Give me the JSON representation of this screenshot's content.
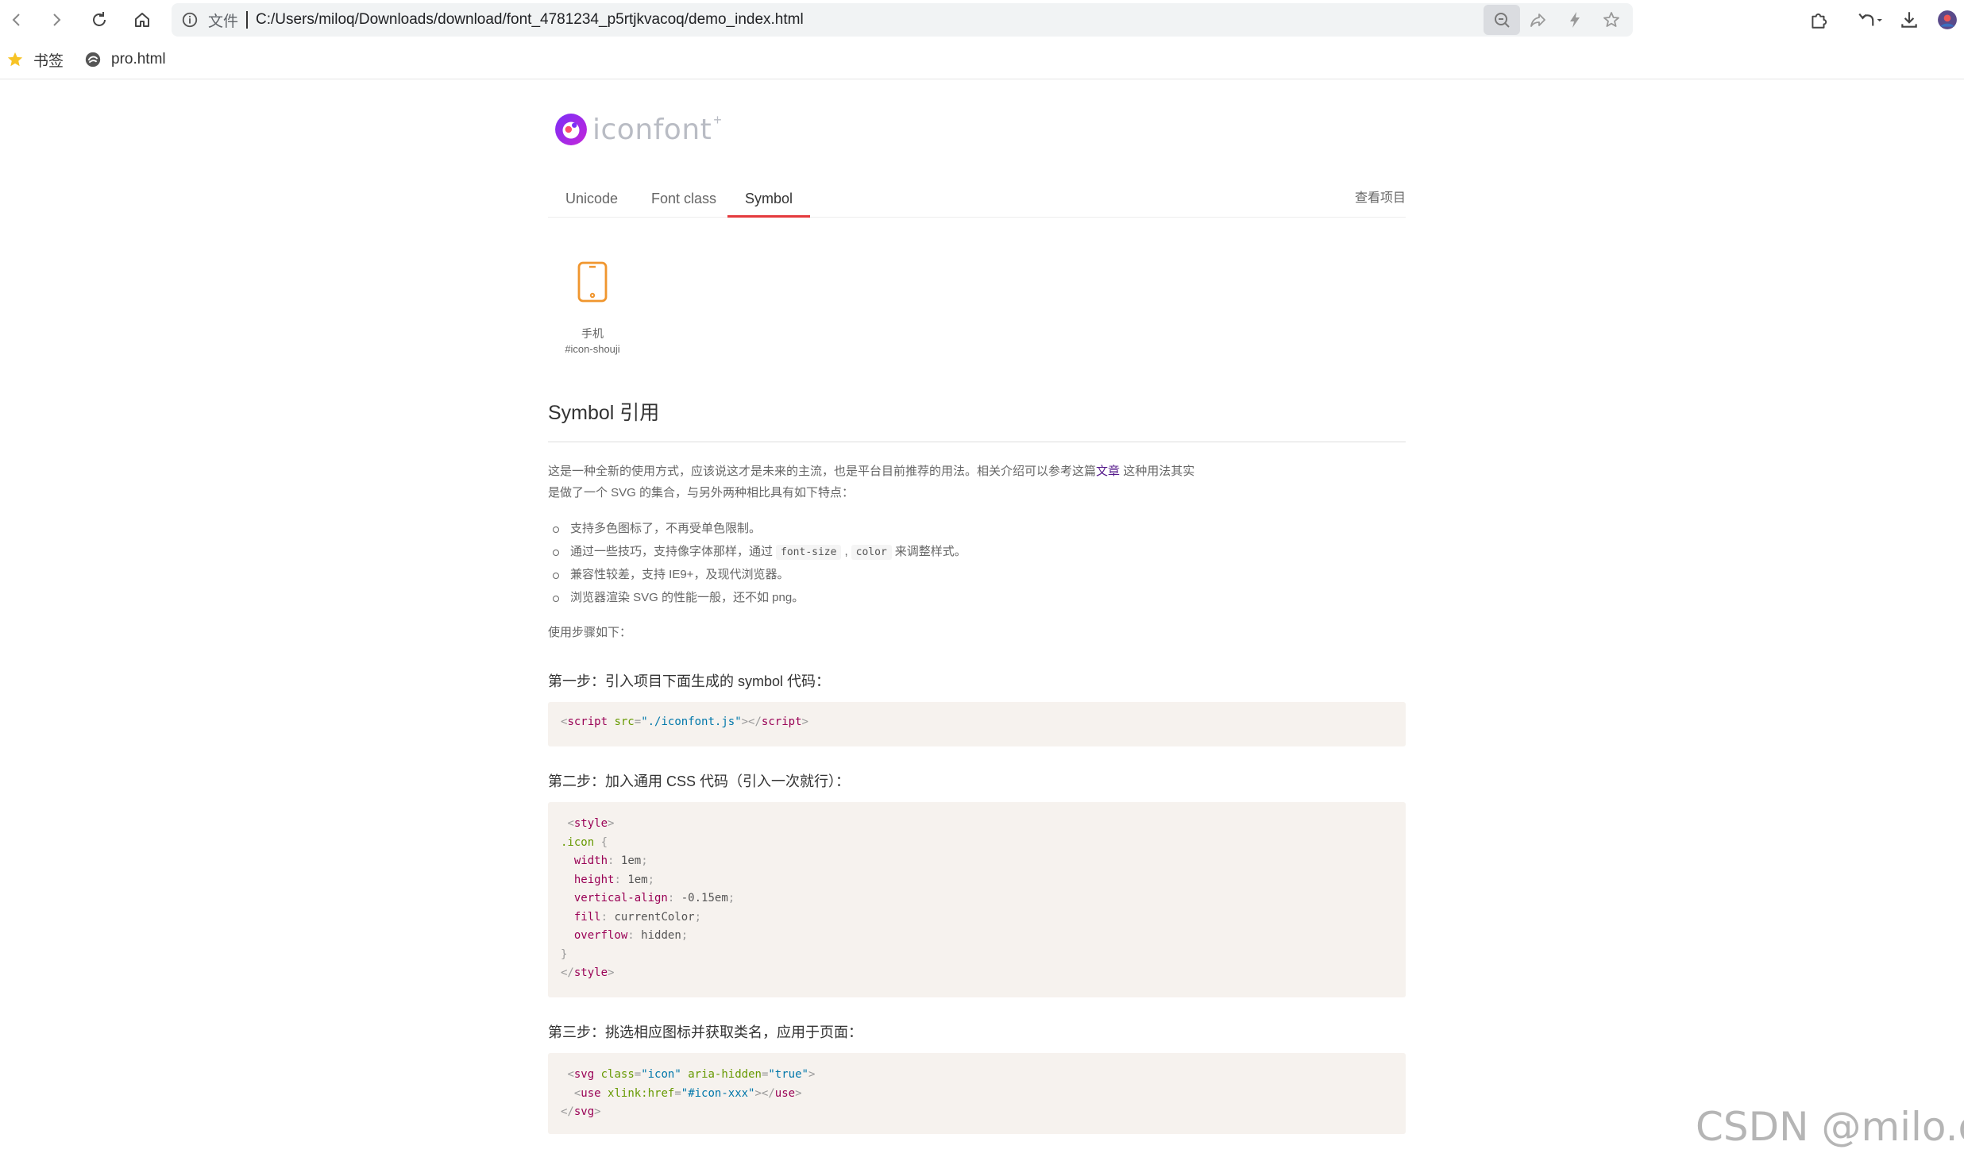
{
  "browser": {
    "url_scheme_label": "文件",
    "url": "C:/Users/miloq/Downloads/download/font_4781234_p5rtjkvacoq/demo_index.html",
    "bookmarks": [
      {
        "label": "书签",
        "icon": "star-icon"
      },
      {
        "label": "pro.html",
        "icon": "page-icon"
      }
    ]
  },
  "page": {
    "logo_text": "iconfont",
    "logo_plus": "+",
    "tabs": [
      "Unicode",
      "Font class",
      "Symbol"
    ],
    "active_tab": "Symbol",
    "view_project": "查看项目",
    "icons": [
      {
        "name": "手机",
        "code": "#icon-shouji",
        "color": "#f0962e"
      }
    ],
    "section_title": "Symbol 引用",
    "intro_part1": "这是一种全新的使用方式，应该说这才是未来的主流，也是平台目前推荐的用法。相关介绍可以参考这篇",
    "intro_link": "文章",
    "intro_part2": " 这种用法其实",
    "intro_line2": "是做了一个 SVG 的集合，与另外两种相比具有如下特点：",
    "features": {
      "f1": "支持多色图标了，不再受单色限制。",
      "f2_pre": "通过一些技巧，支持像字体那样，通过",
      "f2_code1": "font-size",
      "f2_sep": ",",
      "f2_code2": "color",
      "f2_post": "来调整样式。",
      "f3": "兼容性较差，支持 IE9+，及现代浏览器。",
      "f4": "浏览器渲染 SVG 的性能一般，还不如 png。"
    },
    "steps_intro": "使用步骤如下：",
    "step1": "第一步：引入项目下面生成的 symbol 代码：",
    "step2": "第二步：加入通用 CSS 代码（引入一次就行）：",
    "step3": "第三步：挑选相应图标并获取类名，应用于页面：",
    "code1": {
      "tag": "script",
      "attr": "src",
      "value": "\"./iconfont.js\"",
      "close": "script"
    },
    "code2": {
      "open": "style",
      "selector": ".icon",
      "props": [
        {
          "p": "width",
          "v": "1em"
        },
        {
          "p": "height",
          "v": "1em"
        },
        {
          "p": "vertical-align",
          "v": "-0.15em"
        },
        {
          "p": "fill",
          "v": "currentColor"
        },
        {
          "p": "overflow",
          "v": "hidden"
        }
      ],
      "close": "style"
    },
    "code3": {
      "svg_tag": "svg",
      "class_attr": "class",
      "class_val": "\"icon\"",
      "aria_attr": "aria-hidden",
      "aria_val": "\"true\"",
      "use_tag": "use",
      "href_attr": "xlink:href",
      "href_val": "\"#icon-xxx\""
    }
  },
  "watermark": "CSDN @milo.qu",
  "colors": {
    "accent_tab": "#e4393c",
    "icon_orange": "#f0962e",
    "code_bg": "#f6f2ee"
  }
}
